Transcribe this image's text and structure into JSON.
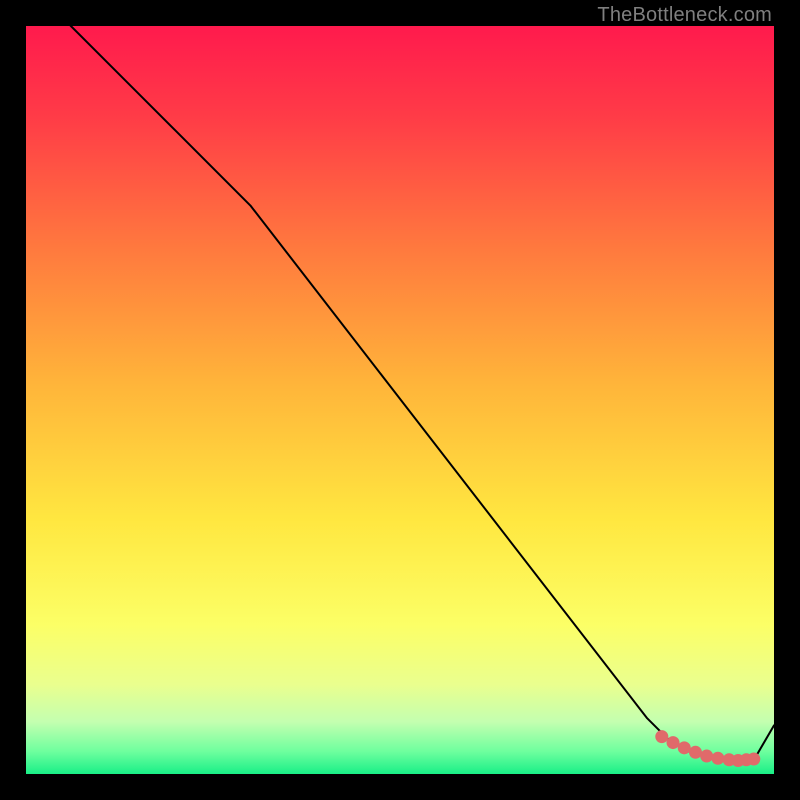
{
  "watermark": "TheBottleneck.com",
  "chart_data": {
    "type": "line",
    "title": "",
    "xlabel": "",
    "ylabel": "",
    "xlim": [
      0,
      100
    ],
    "ylim": [
      0,
      100
    ],
    "series": [
      {
        "name": "curve",
        "x": [
          0,
          20,
          30,
          83,
          86,
          89,
          92,
          94,
          95.5,
          97.5,
          100
        ],
        "values": [
          106,
          86,
          76,
          7.5,
          4.5,
          2.8,
          2.0,
          1.8,
          1.8,
          2.2,
          6.5
        ],
        "note": "values expressed as percent of plot height from bottom; 0..100 scale"
      }
    ],
    "markers": {
      "name": "highlight-dots",
      "x": [
        85.0,
        86.5,
        88.0,
        89.5,
        91.0,
        92.5,
        94.0,
        95.2,
        96.3,
        97.3
      ],
      "values": [
        5.0,
        4.2,
        3.5,
        2.9,
        2.4,
        2.1,
        1.9,
        1.8,
        1.9,
        2.0
      ]
    },
    "background_gradient": {
      "stops": [
        {
          "pct": 0,
          "color": "#ff1a4d"
        },
        {
          "pct": 12,
          "color": "#ff3b47"
        },
        {
          "pct": 30,
          "color": "#ff7a3e"
        },
        {
          "pct": 48,
          "color": "#ffb53a"
        },
        {
          "pct": 66,
          "color": "#ffe740"
        },
        {
          "pct": 80,
          "color": "#fcff66"
        },
        {
          "pct": 88,
          "color": "#eaff8e"
        },
        {
          "pct": 93,
          "color": "#c4ffb0"
        },
        {
          "pct": 97,
          "color": "#6eff9e"
        },
        {
          "pct": 100,
          "color": "#19ef87"
        }
      ]
    },
    "marker_color": "#e06a6a",
    "line_color": "#000000"
  }
}
